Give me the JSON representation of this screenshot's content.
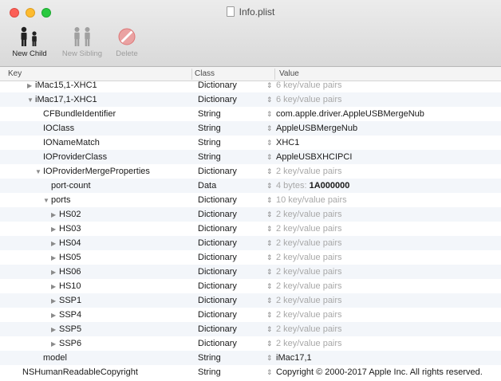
{
  "window": {
    "title": "Info.plist"
  },
  "toolbar": {
    "new_child": "New Child",
    "new_sibling": "New Sibling",
    "delete": "Delete"
  },
  "columns": {
    "key": "Key",
    "class": "Class",
    "value": "Value"
  },
  "rows": [
    {
      "key": "iMac15,1-XHC1",
      "class": "Dictionary",
      "value": "6 key/value pairs",
      "dim": true,
      "disclosure": "collapsed"
    },
    {
      "key": "iMac17,1-XHC1",
      "class": "Dictionary",
      "value": "6 key/value pairs",
      "dim": true,
      "disclosure": "expanded"
    },
    {
      "key": "CFBundleIdentifier",
      "class": "String",
      "value": "com.apple.driver.AppleUSBMergeNub",
      "dim": false,
      "disclosure": "none"
    },
    {
      "key": "IOClass",
      "class": "String",
      "value": "AppleUSBMergeNub",
      "dim": false,
      "disclosure": "none"
    },
    {
      "key": "IONameMatch",
      "class": "String",
      "value": "XHC1",
      "dim": false,
      "disclosure": "none"
    },
    {
      "key": "IOProviderClass",
      "class": "String",
      "value": "AppleUSBXHCIPCI",
      "dim": false,
      "disclosure": "none"
    },
    {
      "key": "IOProviderMergeProperties",
      "class": "Dictionary",
      "value": "2 key/value pairs",
      "dim": true,
      "disclosure": "expanded"
    },
    {
      "key": "port-count",
      "class": "Data",
      "value": "4 bytes:",
      "value_bold": "1A000000",
      "dim": true,
      "disclosure": "none"
    },
    {
      "key": "ports",
      "class": "Dictionary",
      "value": "10 key/value pairs",
      "dim": true,
      "disclosure": "expanded"
    },
    {
      "key": "HS02",
      "class": "Dictionary",
      "value": "2 key/value pairs",
      "dim": true,
      "disclosure": "collapsed"
    },
    {
      "key": "HS03",
      "class": "Dictionary",
      "value": "2 key/value pairs",
      "dim": true,
      "disclosure": "collapsed"
    },
    {
      "key": "HS04",
      "class": "Dictionary",
      "value": "2 key/value pairs",
      "dim": true,
      "disclosure": "collapsed"
    },
    {
      "key": "HS05",
      "class": "Dictionary",
      "value": "2 key/value pairs",
      "dim": true,
      "disclosure": "collapsed"
    },
    {
      "key": "HS06",
      "class": "Dictionary",
      "value": "2 key/value pairs",
      "dim": true,
      "disclosure": "collapsed"
    },
    {
      "key": "HS10",
      "class": "Dictionary",
      "value": "2 key/value pairs",
      "dim": true,
      "disclosure": "collapsed"
    },
    {
      "key": "SSP1",
      "class": "Dictionary",
      "value": "2 key/value pairs",
      "dim": true,
      "disclosure": "collapsed"
    },
    {
      "key": "SSP4",
      "class": "Dictionary",
      "value": "2 key/value pairs",
      "dim": true,
      "disclosure": "collapsed"
    },
    {
      "key": "SSP5",
      "class": "Dictionary",
      "value": "2 key/value pairs",
      "dim": true,
      "disclosure": "collapsed"
    },
    {
      "key": "SSP6",
      "class": "Dictionary",
      "value": "2 key/value pairs",
      "dim": true,
      "disclosure": "collapsed"
    },
    {
      "key": "model",
      "class": "String",
      "value": "iMac17,1",
      "dim": false,
      "disclosure": "none"
    },
    {
      "key": "NSHumanReadableCopyright",
      "class": "String",
      "value": "Copyright © 2000-2017 Apple Inc. All rights reserved.",
      "dim": false,
      "disclosure": "none"
    }
  ],
  "icons": {
    "new_child": "new-child-icon",
    "new_sibling": "new-sibling-icon",
    "delete": "delete-icon",
    "disclosure_expanded": "disclosure-expanded-icon",
    "disclosure_collapsed": "disclosure-collapsed-icon",
    "stepper": "stepper-icon"
  },
  "colors": {
    "close": "#fc5f57",
    "minimize": "#fdbb2e",
    "zoom": "#29c940",
    "delete_red": "#e05a5a"
  }
}
